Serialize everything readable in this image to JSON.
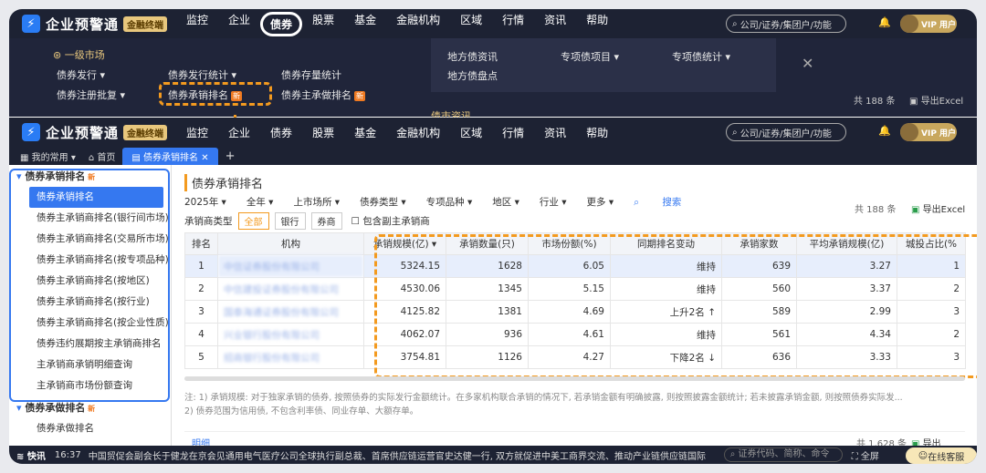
{
  "app": {
    "title": "企业预警通",
    "badge": "金融终端",
    "logo_glyph": "⚡"
  },
  "nav": [
    "监控",
    "企业",
    "债券",
    "股票",
    "基金",
    "金融机构",
    "区域",
    "行情",
    "资讯",
    "帮助"
  ],
  "nav_active": "债券",
  "search_placeholder": "公司/证券/集团户/功能",
  "vip_label": "VIP 用户",
  "dropdown": {
    "section": "一级市场",
    "items": [
      "债券发行 ▾",
      "债券发行统计 ▾",
      "债券存量统计",
      "债券注册批复 ▾",
      "债券承销排名",
      "债券主承做排名"
    ],
    "right_items": [
      "地方债资讯",
      "专项债项目 ▾",
      "专项债统计 ▾",
      "地方债盘点"
    ],
    "news": "债市资讯",
    "count": "共 188 条",
    "export": "导出Excel"
  },
  "tabs": {
    "my": "我的常用",
    "home": "首页",
    "active": "债券承销排名"
  },
  "sidebar": {
    "head1": "债券承销排名",
    "items": [
      "债券承销排名",
      "债券主承销商排名(银行间市场)",
      "债券主承销商排名(交易所市场)",
      "债券主承销商排名(按专项品种)",
      "债券主承销商排名(按地区)",
      "债券主承销商排名(按行业)",
      "债券主承销商排名(按企业性质)",
      "债券违约展期按主承销商排名",
      "主承销商承销明细查询",
      "主承销商市场份额查询"
    ],
    "head2": "债券承做排名",
    "sub2": "债券承做排名"
  },
  "main": {
    "title": "债券承销排名",
    "filters": [
      "2025年 ▾",
      "全年 ▾",
      "上市场所 ▾",
      "债券类型 ▾",
      "专项品种 ▾",
      "地区 ▾",
      "行业 ▾",
      "更多 ▾",
      "搜索"
    ],
    "count": "共 188 条",
    "export": "导出Excel",
    "type_label": "承销商类型",
    "type_opts": [
      "全部",
      "银行",
      "券商"
    ],
    "include": "包含副主承销商",
    "columns": [
      "排名",
      "机构",
      "承销规模(亿) ▾",
      "承销数量(只)",
      "市场份额(%)",
      "同期排名变动",
      "承销家数",
      "平均承销规模(亿)",
      "城投占比(%"
    ],
    "rows": [
      [
        "1",
        "中信证券股份有限公司",
        "5324.15",
        "1628",
        "6.05",
        "维持",
        "639",
        "3.27",
        "1"
      ],
      [
        "2",
        "中信建投证券股份有限公司",
        "4530.06",
        "1345",
        "5.15",
        "维持",
        "560",
        "3.37",
        "2"
      ],
      [
        "3",
        "国泰海通证券股份有限公司",
        "4125.82",
        "1381",
        "4.69",
        "上升2名 ↑",
        "589",
        "2.99",
        "3"
      ],
      [
        "4",
        "兴业银行股份有限公司",
        "4062.07",
        "936",
        "4.61",
        "维持",
        "561",
        "4.34",
        "2"
      ],
      [
        "5",
        "招商银行股份有限公司",
        "3754.81",
        "1126",
        "4.27",
        "下降2名 ↓",
        "636",
        "3.33",
        "3"
      ]
    ],
    "notes": [
      "注:  1)  承销规模: 对于独家承销的债券, 按照债券的实际发行金额统计。在多家机构联合承销的情况下, 若承销金额有明确披露, 则按照披露金额统计; 若未披露承销金额, 则按照债券实际发...",
      "       2)  债券范围为信用债, 不包含利率债、同业存单、大额存单。"
    ],
    "detail_tab": "明细",
    "detail_count": "共 1,628 条",
    "detail_export": "导出Excel"
  },
  "ticker": {
    "brand": "快讯",
    "time": "16:37",
    "text": "中国贸促会副会长于健龙在京会见通用电气医疗公司全球执行副总裁、首席供应链运营官史达健一行, 双方就促进中美工商界交流、推动产业链供应链国际",
    "search": "证券代码、简称、命令",
    "fullscreen": "全屏",
    "service": "在线客服"
  }
}
